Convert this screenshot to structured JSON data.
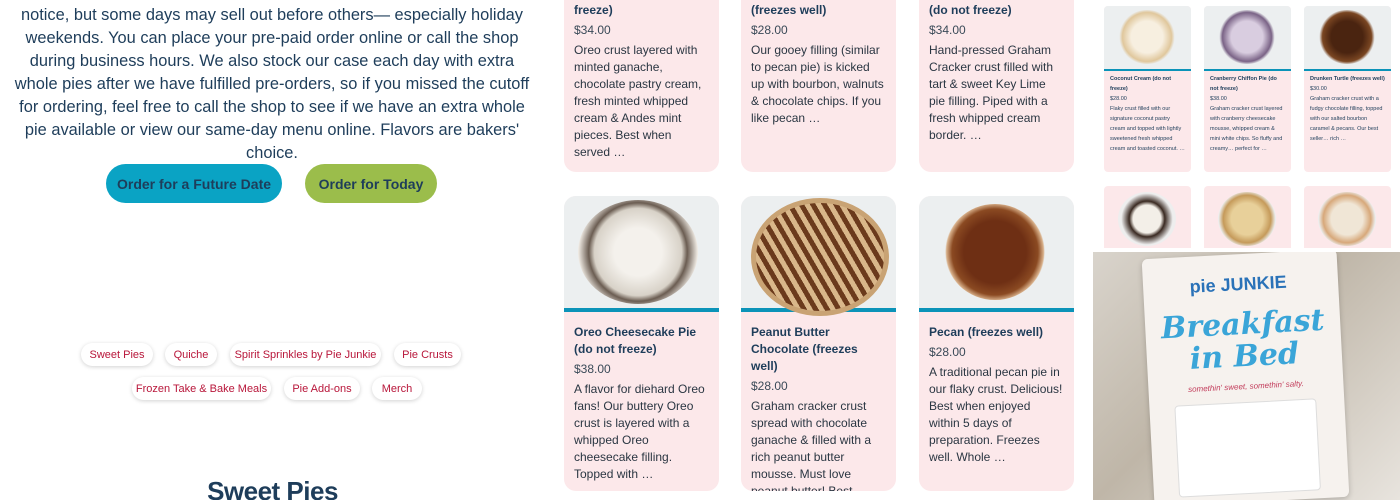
{
  "intro": {
    "text": "notice, but some days may sell out before others— especially holiday weekends. You can place your pre-paid order online or call the shop during business hours. We also stock our case each day with extra whole pies after we have fulfilled pre-orders, so if you missed the cutoff for ordering, feel free to call the shop to see if we have an extra whole pie available or view our same-day menu online. Flavors are bakers' choice."
  },
  "buttons": {
    "future": "Order for a Future Date",
    "today": "Order for Today"
  },
  "categories": [
    "Sweet Pies",
    "Quiche",
    "Spirit Sprinkles by Pie Junkie",
    "Pie Crusts",
    "Frozen Take & Bake Meals",
    "Pie Add-ons",
    "Merch"
  ],
  "section_heading": "Sweet Pies",
  "top_cards": [
    {
      "name": "freeze)",
      "price": "$34.00",
      "desc": "Oreo crust layered with minted ganache, chocolate pastry cream, fresh minted whipped cream & Andes mint pieces. Best when served …"
    },
    {
      "name": "(freezes well)",
      "price": "$28.00",
      "desc": "Our gooey filling (similar to pecan pie) is kicked up with bourbon, walnuts & chocolate chips. If you like pecan …"
    },
    {
      "name": "(do not freeze)",
      "price": "$34.00",
      "desc": "Hand-pressed Graham Cracker crust filled with tart & sweet Key Lime pie filling. Piped with a fresh whipped cream border. …"
    }
  ],
  "bottom_cards": [
    {
      "name": "Oreo Cheesecake Pie (do not freeze)",
      "price": "$38.00",
      "desc": "A flavor for diehard Oreo fans! Our buttery Oreo crust is layered with a whipped Oreo cheesecake filling. Topped with …"
    },
    {
      "name": "Peanut Butter Chocolate (freezes well)",
      "price": "$28.00",
      "desc": "Graham cracker crust spread with chocolate ganache & filled with a rich peanut butter mousse. Must love peanut butter! Best …"
    },
    {
      "name": "Pecan (freezes well)",
      "price": "$28.00",
      "desc": "A traditional pecan pie in our flaky crust. Delicious! Best when enjoyed within 5 days of preparation. Freezes well. Whole …"
    }
  ],
  "mini_cards": [
    {
      "name": "Coconut Cream (do not freeze)",
      "price": "$28.00",
      "desc": "Flaky crust filled with our signature coconut pastry cream and topped with lightly sweetened fresh whipped cream and toasted coconut. …"
    },
    {
      "name": "Cranberry Chiffon Pie (do not freeze)",
      "price": "$38.00",
      "desc": "Graham cracker crust layered with cranberry cheesecake mousse, whipped cream & mini white chips. So fluffy and creamy… perfect for …"
    },
    {
      "name": "Drunken Turtle (freezes well)",
      "price": "$30.00",
      "desc": "Graham cracker crust with a fudgy chocolate filling, topped with our salted bourbon caramel & pecans. Our best seller… rich …"
    }
  ],
  "photo_label": {
    "brand": "pie JUNKIE",
    "title": "Breakfast in Bed",
    "tagline": "somethin' sweet, somethin' salty."
  }
}
